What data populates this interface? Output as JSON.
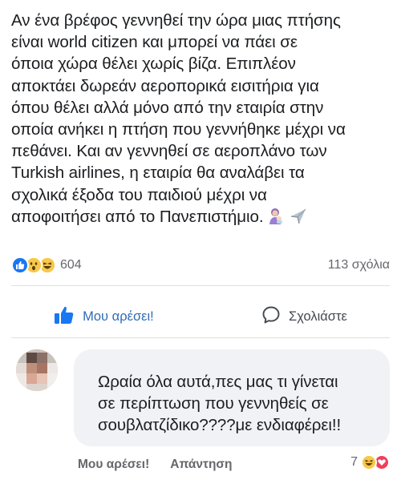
{
  "post": {
    "lines": [
      "Αν ένα βρέφος γεννηθεί την ώρα μιας πτήσης",
      "είναι world citizen και μπορεί να πάει σε",
      "όποια χώρα θέλει χωρίς βίζα. Επιπλέον",
      "αποκτάει δωρεάν αεροπορικά εισιτήρια για",
      "όπου θέλει αλλά μόνο από την εταιρία στην",
      "οποία ανήκει η πτήση που γεννήθηκε μέχρι να",
      "πεθάνει. Και αν γεννηθεί σε αεροπλάνο των",
      "Turkish airlines, η εταιρία θα αναλάβει τα",
      "σχολικά έξοδα του παιδιού μέχρι να",
      "αποφοιτήσει από το Πανεπιστήμιο."
    ],
    "trailing_emojis": [
      "woman-feeding-baby-icon",
      "airplane-icon"
    ]
  },
  "reactions": {
    "icons": [
      "like-icon",
      "wow-icon",
      "haha-icon"
    ],
    "count": "604",
    "comments": "113 σχόλια"
  },
  "actions": {
    "like_label": "Μου αρέσει!",
    "comment_label": "Σχολιάστε"
  },
  "comment": {
    "lines": [
      "Ωραία όλα αυτά,πες μας τι γίνεται",
      "σε περίπτωση που γεννηθείς σε",
      "σουβλατζίδικο????με ενδιαφέρει!!"
    ],
    "like_label": "Μου αρέσει!",
    "reply_label": "Απάντηση",
    "reaction_count": "7",
    "reaction_icons": [
      "haha-icon",
      "love-icon"
    ]
  },
  "colors": {
    "brand_blue": "#1877f2",
    "like_text": "#2d6bb7",
    "secondary_text": "#65676b",
    "bubble_bg": "#f0f2f5"
  }
}
